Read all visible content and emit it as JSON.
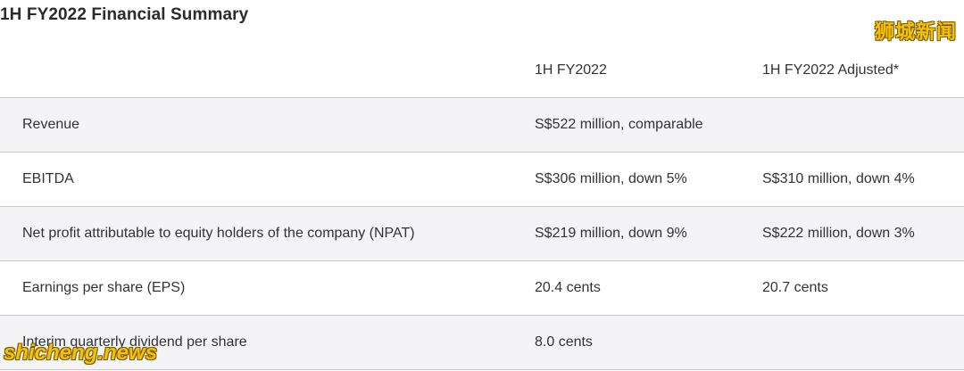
{
  "title": "1H FY2022 Financial Summary",
  "table": {
    "headers": [
      "",
      "1H FY2022",
      "1H FY2022 Adjusted*"
    ],
    "rows": [
      [
        "Revenue",
        "S$522 million, comparable",
        ""
      ],
      [
        "EBITDA",
        "S$306 million, down 5%",
        "S$310 million, down 4%"
      ],
      [
        "Net profit attributable to equity holders of the company (NPAT)",
        "S$219 million, down 9%",
        "S$222 million, down 3%"
      ],
      [
        "Earnings per share (EPS)",
        "20.4 cents",
        "20.7 cents"
      ],
      [
        "Interim quarterly dividend per share",
        "8.0 cents",
        ""
      ]
    ]
  },
  "watermarks": {
    "top_right": "狮城新闻",
    "bottom_left": "shicheng.news"
  }
}
